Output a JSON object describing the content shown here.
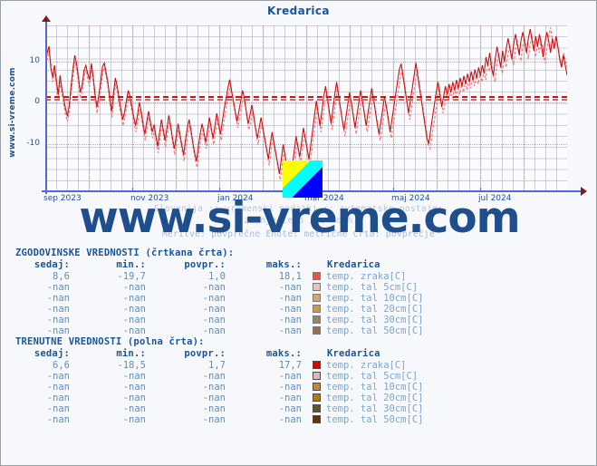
{
  "chart": {
    "title": "Kredarica",
    "vertical_label": "www.si-vreme.com",
    "watermark": "www.si-vreme.com",
    "subtitle_line1": "Slovenija :: vremenski podatki :: avtomatske postaje:",
    "subtitle_line2": "zadnje leto / en dan",
    "subtitle_line3": "Meritve: povprečne  Enote: metrične  Črta: povprečje"
  },
  "chart_data": {
    "type": "line",
    "title": "Kredarica",
    "xlabel": "",
    "ylabel": "temp. zraka [C]",
    "ylim": [
      -18.5,
      18.1
    ],
    "yticks": [
      10,
      0,
      -10
    ],
    "ytick_labels": [
      "10",
      "0",
      "-10"
    ],
    "xticks": [
      "sep 2023",
      "nov 2023",
      "jan 2024",
      "mar 2024",
      "maj 2024",
      "jul 2024"
    ],
    "grid": true,
    "legend_position": "below-table",
    "reference_lines": [
      {
        "name": "povprečje (trenutne)",
        "value": 1.7,
        "style": "dashed",
        "color": "#cc1111"
      },
      {
        "name": "povprečje (zgodovinske)",
        "value": 1.0,
        "style": "dashed",
        "color": "#e06060"
      }
    ],
    "series": [
      {
        "name": "temp. zraka[C] — trenutne vrednosti (polna črta)",
        "style": "solid",
        "color": "#cc1111",
        "stats": {
          "sedaj": 6.6,
          "min": -18.5,
          "povpr": 1.7,
          "maks": 17.7
        },
        "values": [
          10.2,
          12.0,
          13.6,
          8.3,
          6.2,
          9.0,
          5.4,
          2.0,
          6.6,
          3.4,
          1.0,
          -1.5,
          -3.2,
          -0.5,
          4.0,
          8.2,
          11.4,
          9.4,
          6.0,
          2.5,
          4.2,
          7.8,
          9.0,
          7.0,
          5.5,
          9.5,
          6.2,
          2.0,
          -1.0,
          1.8,
          5.0,
          8.6,
          9.6,
          7.2,
          4.8,
          1.0,
          -2.0,
          2.4,
          6.0,
          4.0,
          1.2,
          -1.6,
          -4.0,
          -2.2,
          0.6,
          3.0,
          1.4,
          -1.0,
          -3.5,
          -5.5,
          -3.0,
          0.2,
          -2.0,
          -5.0,
          -7.5,
          -4.6,
          -2.0,
          -4.5,
          -7.0,
          -5.2,
          -8.0,
          -10.5,
          -7.0,
          -4.0,
          -6.5,
          -9.0,
          -6.0,
          -3.0,
          -5.5,
          -8.5,
          -11.0,
          -8.0,
          -5.0,
          -7.5,
          -10.0,
          -12.5,
          -9.0,
          -6.0,
          -4.0,
          -6.5,
          -9.5,
          -12.0,
          -14.0,
          -10.5,
          -7.5,
          -5.0,
          -7.0,
          -9.5,
          -6.5,
          -3.5,
          -6.0,
          -8.5,
          -5.5,
          -2.5,
          -5.0,
          -7.5,
          -4.5,
          -1.5,
          1.0,
          3.5,
          5.6,
          3.0,
          0.5,
          -2.0,
          -4.5,
          -2.0,
          0.5,
          3.0,
          1.0,
          -2.0,
          -5.0,
          -3.0,
          -0.5,
          -3.0,
          -6.0,
          -8.5,
          -6.0,
          -3.5,
          -6.0,
          -8.5,
          -11.0,
          -13.5,
          -10.0,
          -7.0,
          -9.5,
          -12.0,
          -14.5,
          -17.0,
          -13.5,
          -10.0,
          -12.5,
          -15.0,
          -17.5,
          -18.5,
          -15.0,
          -11.5,
          -8.0,
          -10.5,
          -13.0,
          -9.5,
          -6.0,
          -8.5,
          -11.0,
          -13.5,
          -10.0,
          -6.5,
          -3.0,
          0.5,
          -2.5,
          -5.5,
          -2.0,
          1.5,
          4.0,
          1.0,
          -2.0,
          -5.0,
          -1.5,
          2.0,
          5.0,
          2.0,
          -1.0,
          -4.0,
          -6.5,
          -3.5,
          -0.5,
          2.5,
          0.0,
          -3.0,
          -6.0,
          -3.0,
          0.0,
          3.0,
          0.5,
          -2.5,
          -5.5,
          -2.5,
          0.5,
          3.5,
          1.0,
          -2.0,
          -5.0,
          -7.5,
          -4.5,
          -1.5,
          1.5,
          -1.0,
          -4.0,
          -7.0,
          -4.0,
          -1.0,
          2.0,
          5.0,
          8.0,
          9.4,
          6.5,
          3.5,
          0.5,
          -2.5,
          0.5,
          3.5,
          6.5,
          9.6,
          6.5,
          3.5,
          0.5,
          -2.5,
          -5.5,
          -8.5,
          -9.8,
          -6.5,
          -3.5,
          -0.5,
          2.5,
          5.0,
          2.0,
          -1.0,
          1.5,
          4.0,
          2.0,
          4.5,
          2.5,
          5.0,
          3.0,
          5.5,
          3.5,
          6.0,
          4.0,
          6.5,
          4.5,
          7.0,
          5.0,
          7.5,
          5.5,
          8.0,
          6.0,
          8.5,
          6.5,
          9.0,
          7.0,
          11.0,
          9.0,
          12.0,
          8.5,
          6.5,
          10.5,
          13.5,
          11.0,
          8.5,
          12.5,
          10.0,
          13.0,
          15.5,
          13.0,
          10.5,
          14.0,
          16.5,
          14.0,
          11.5,
          15.0,
          17.0,
          14.5,
          12.0,
          15.5,
          17.7,
          15.0,
          12.5,
          16.0,
          13.5,
          16.5,
          14.0,
          11.0,
          14.5,
          17.0,
          15.0,
          12.0,
          15.5,
          13.0,
          16.0,
          13.5,
          10.5,
          8.5,
          11.5,
          9.0,
          6.6
        ]
      },
      {
        "name": "temp. zraka[C] — zgodovinske vrednosti (črtkana črta)",
        "style": "dashed",
        "color": "#ec8080",
        "stats": {
          "sedaj": 8.6,
          "min": -19.7,
          "povpr": 1.0,
          "maks": 18.1
        },
        "values": [
          8.0,
          10.5,
          12.5,
          9.8,
          5.0,
          7.5,
          4.0,
          1.0,
          5.0,
          2.0,
          -0.5,
          -3.0,
          -4.5,
          -2.0,
          2.5,
          6.5,
          10.0,
          8.0,
          4.5,
          1.0,
          2.8,
          6.5,
          8.0,
          5.5,
          4.0,
          8.0,
          5.0,
          0.5,
          -2.5,
          0.5,
          3.5,
          7.0,
          8.5,
          6.0,
          3.5,
          -0.5,
          -3.5,
          1.0,
          4.5,
          2.5,
          -0.5,
          -3.0,
          -5.5,
          -3.5,
          -0.8,
          1.5,
          0.0,
          -2.5,
          -5.0,
          -7.0,
          -4.5,
          -1.5,
          -3.5,
          -6.5,
          -9.0,
          -6.0,
          -3.5,
          -6.0,
          -8.5,
          -6.5,
          -9.5,
          -12.0,
          -8.5,
          -5.5,
          -8.0,
          -10.5,
          -7.5,
          -4.5,
          -7.0,
          -10.0,
          -12.5,
          -9.5,
          -6.5,
          -9.0,
          -11.5,
          -14.0,
          -10.5,
          -7.5,
          -5.5,
          -8.0,
          -11.0,
          -13.5,
          -15.5,
          -12.0,
          -9.0,
          -6.5,
          -8.5,
          -11.0,
          -8.0,
          -5.0,
          -7.5,
          -10.0,
          -7.0,
          -4.0,
          -6.5,
          -9.0,
          -6.0,
          -3.0,
          -0.5,
          2.0,
          4.0,
          1.5,
          -1.0,
          -3.5,
          -6.0,
          -3.5,
          -1.0,
          1.5,
          -0.5,
          -3.5,
          -6.5,
          -4.5,
          -2.0,
          -4.5,
          -7.5,
          -10.0,
          -7.5,
          -5.0,
          -7.5,
          -10.0,
          -12.5,
          -15.0,
          -11.5,
          -8.5,
          -11.0,
          -13.5,
          -16.0,
          -18.5,
          -15.0,
          -11.5,
          -14.0,
          -16.5,
          -19.0,
          -19.7,
          -16.5,
          -13.0,
          -9.5,
          -12.0,
          -14.5,
          -11.0,
          -7.5,
          -10.0,
          -12.5,
          -15.0,
          -11.5,
          -8.0,
          -4.5,
          -1.0,
          -4.0,
          -7.0,
          -3.5,
          0.0,
          2.5,
          -0.5,
          -3.5,
          -6.5,
          -3.0,
          0.5,
          3.5,
          0.5,
          -2.5,
          -5.5,
          -8.0,
          -5.0,
          -2.0,
          1.0,
          -1.5,
          -4.5,
          -7.5,
          -4.5,
          -1.5,
          1.5,
          -1.0,
          -4.0,
          -7.0,
          -4.0,
          -1.0,
          2.0,
          -0.5,
          -3.5,
          -6.5,
          -9.0,
          -6.0,
          -3.0,
          0.0,
          -2.5,
          -5.5,
          -8.5,
          -5.5,
          -2.5,
          0.5,
          3.5,
          6.5,
          8.0,
          5.0,
          2.0,
          -1.0,
          -4.0,
          -1.0,
          2.0,
          5.0,
          8.0,
          5.0,
          2.0,
          -1.0,
          -4.0,
          -7.0,
          -10.0,
          -11.0,
          -8.0,
          -5.0,
          -2.0,
          1.0,
          3.5,
          0.5,
          -2.5,
          0.0,
          2.5,
          0.5,
          3.0,
          1.0,
          3.5,
          1.5,
          4.0,
          2.0,
          4.5,
          2.5,
          5.0,
          3.0,
          5.5,
          3.5,
          6.0,
          4.0,
          6.5,
          4.5,
          7.0,
          5.0,
          7.5,
          5.5,
          9.5,
          7.5,
          10.5,
          7.0,
          5.0,
          9.0,
          12.0,
          9.5,
          7.0,
          11.0,
          8.5,
          11.5,
          14.0,
          11.5,
          9.0,
          12.5,
          15.0,
          12.5,
          10.0,
          13.5,
          15.5,
          13.0,
          10.5,
          14.0,
          16.2,
          13.5,
          11.0,
          14.5,
          12.0,
          15.0,
          12.5,
          9.5,
          13.0,
          15.5,
          18.1,
          15.5,
          13.0,
          16.0,
          13.5,
          11.0,
          9.0,
          12.0,
          10.5,
          8.6
        ]
      }
    ]
  },
  "tables": [
    {
      "heading": "ZGODOVINSKE VREDNOSTI (črtkana črta):",
      "columns": [
        "sedaj:",
        "min.:",
        "povpr.:",
        "maks.:",
        "Kredarica"
      ],
      "rows": [
        {
          "sedaj": "8,6",
          "min": "-19,7",
          "povpr": "1,0",
          "maks": "18,1",
          "label": "temp. zraka[C]",
          "color": "#e81010"
        },
        {
          "sedaj": "-nan",
          "min": "-nan",
          "povpr": "-nan",
          "maks": "-nan",
          "label": "temp. tal  5cm[C]",
          "color": "#d9b0aa"
        },
        {
          "sedaj": "-nan",
          "min": "-nan",
          "povpr": "-nan",
          "maks": "-nan",
          "label": "temp. tal 10cm[C]",
          "color": "#c08a3e"
        },
        {
          "sedaj": "-nan",
          "min": "-nan",
          "povpr": "-nan",
          "maks": "-nan",
          "label": "temp. tal 20cm[C]",
          "color": "#b5770c"
        },
        {
          "sedaj": "-nan",
          "min": "-nan",
          "povpr": "-nan",
          "maks": "-nan",
          "label": "temp. tal 30cm[C]",
          "color": "#6b6033"
        },
        {
          "sedaj": "-nan",
          "min": "-nan",
          "povpr": "-nan",
          "maks": "-nan",
          "label": "temp. tal 50cm[C]",
          "color": "#6b3e10"
        }
      ]
    },
    {
      "heading": "TRENUTNE VREDNOSTI (polna črta):",
      "columns": [
        "sedaj:",
        "min.:",
        "povpr.:",
        "maks.:",
        "Kredarica"
      ],
      "rows": [
        {
          "sedaj": "6,6",
          "min": "-18,5",
          "povpr": "1,7",
          "maks": "17,7",
          "label": "temp. zraka[C]",
          "color": "#dd0000"
        },
        {
          "sedaj": "-nan",
          "min": "-nan",
          "povpr": "-nan",
          "maks": "-nan",
          "label": "temp. tal  5cm[C]",
          "color": "#d8bcbc"
        },
        {
          "sedaj": "-nan",
          "min": "-nan",
          "povpr": "-nan",
          "maks": "-nan",
          "label": "temp. tal 10cm[C]",
          "color": "#bf8a3c"
        },
        {
          "sedaj": "-nan",
          "min": "-nan",
          "povpr": "-nan",
          "maks": "-nan",
          "label": "temp. tal 20cm[C]",
          "color": "#b07d08"
        },
        {
          "sedaj": "-nan",
          "min": "-nan",
          "povpr": "-nan",
          "maks": "-nan",
          "label": "temp. tal 30cm[C]",
          "color": "#5f5733"
        },
        {
          "sedaj": "-nan",
          "min": "-nan",
          "povpr": "-nan",
          "maks": "-nan",
          "label": "temp. tal 50cm[C]",
          "color": "#5e3508"
        }
      ]
    }
  ]
}
